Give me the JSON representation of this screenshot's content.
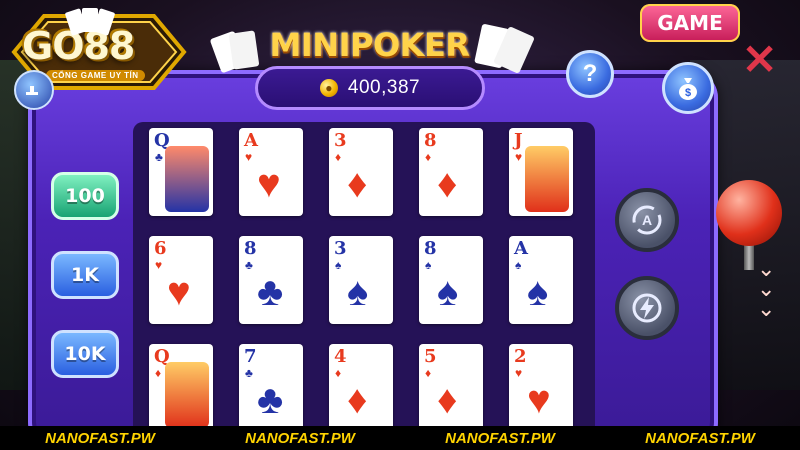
{
  "header": {
    "logo_text": "GO88",
    "logo_tagline": "CỔNG GAME UY TÍN",
    "title": "MINIPOKER",
    "game_badge": "GAME",
    "balance": "400,387"
  },
  "icons": {
    "help": "question-icon",
    "cashout": "money-bag-icon",
    "close": "close-icon",
    "auto": "auto-spin-icon",
    "fast": "lightning-icon"
  },
  "bets": [
    {
      "label": "100",
      "active": true
    },
    {
      "label": "1K",
      "active": false
    },
    {
      "label": "10K",
      "active": false
    }
  ],
  "reels": [
    [
      {
        "rank": "Q",
        "suit": "♣",
        "color": "black",
        "face": true
      },
      {
        "rank": "A",
        "suit": "♥",
        "color": "red",
        "face": false
      },
      {
        "rank": "3",
        "suit": "♦",
        "color": "red",
        "face": false
      },
      {
        "rank": "8",
        "suit": "♦",
        "color": "red",
        "face": false
      },
      {
        "rank": "J",
        "suit": "♥",
        "color": "red",
        "face": true
      }
    ],
    [
      {
        "rank": "6",
        "suit": "♥",
        "color": "red",
        "face": false
      },
      {
        "rank": "8",
        "suit": "♣",
        "color": "black",
        "face": false
      },
      {
        "rank": "3",
        "suit": "♠",
        "color": "black",
        "face": false
      },
      {
        "rank": "8",
        "suit": "♠",
        "color": "black",
        "face": false
      },
      {
        "rank": "A",
        "suit": "♠",
        "color": "black",
        "face": false
      }
    ],
    [
      {
        "rank": "Q",
        "suit": "♦",
        "color": "red",
        "face": true
      },
      {
        "rank": "7",
        "suit": "♣",
        "color": "black",
        "face": false
      },
      {
        "rank": "4",
        "suit": "♦",
        "color": "red",
        "face": false
      },
      {
        "rank": "5",
        "suit": "♦",
        "color": "red",
        "face": false
      },
      {
        "rank": "2",
        "suit": "♥",
        "color": "red",
        "face": false
      }
    ]
  ],
  "watermarks": [
    "NANOFAST.PW",
    "NANOFAST.PW",
    "NANOFAST.PW",
    "NANOFAST.PW"
  ],
  "colors": {
    "frame": "#4b22b6",
    "title": "#ffd34a",
    "bet_active": "#18a373",
    "bet_normal": "#2a5fe0",
    "card_red": "#e83a1e",
    "card_black": "#2433a6"
  }
}
